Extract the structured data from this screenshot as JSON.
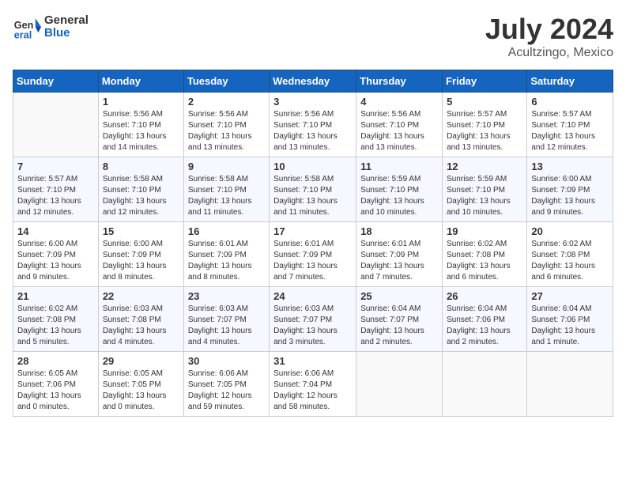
{
  "logo": {
    "line1": "General",
    "line2": "Blue"
  },
  "title": {
    "month_year": "July 2024",
    "location": "Acultzingo, Mexico"
  },
  "days_of_week": [
    "Sunday",
    "Monday",
    "Tuesday",
    "Wednesday",
    "Thursday",
    "Friday",
    "Saturday"
  ],
  "weeks": [
    [
      {
        "day": "",
        "info": ""
      },
      {
        "day": "1",
        "info": "Sunrise: 5:56 AM\nSunset: 7:10 PM\nDaylight: 13 hours\nand 14 minutes."
      },
      {
        "day": "2",
        "info": "Sunrise: 5:56 AM\nSunset: 7:10 PM\nDaylight: 13 hours\nand 13 minutes."
      },
      {
        "day": "3",
        "info": "Sunrise: 5:56 AM\nSunset: 7:10 PM\nDaylight: 13 hours\nand 13 minutes."
      },
      {
        "day": "4",
        "info": "Sunrise: 5:56 AM\nSunset: 7:10 PM\nDaylight: 13 hours\nand 13 minutes."
      },
      {
        "day": "5",
        "info": "Sunrise: 5:57 AM\nSunset: 7:10 PM\nDaylight: 13 hours\nand 13 minutes."
      },
      {
        "day": "6",
        "info": "Sunrise: 5:57 AM\nSunset: 7:10 PM\nDaylight: 13 hours\nand 12 minutes."
      }
    ],
    [
      {
        "day": "7",
        "info": "Sunrise: 5:57 AM\nSunset: 7:10 PM\nDaylight: 13 hours\nand 12 minutes."
      },
      {
        "day": "8",
        "info": "Sunrise: 5:58 AM\nSunset: 7:10 PM\nDaylight: 13 hours\nand 12 minutes."
      },
      {
        "day": "9",
        "info": "Sunrise: 5:58 AM\nSunset: 7:10 PM\nDaylight: 13 hours\nand 11 minutes."
      },
      {
        "day": "10",
        "info": "Sunrise: 5:58 AM\nSunset: 7:10 PM\nDaylight: 13 hours\nand 11 minutes."
      },
      {
        "day": "11",
        "info": "Sunrise: 5:59 AM\nSunset: 7:10 PM\nDaylight: 13 hours\nand 10 minutes."
      },
      {
        "day": "12",
        "info": "Sunrise: 5:59 AM\nSunset: 7:10 PM\nDaylight: 13 hours\nand 10 minutes."
      },
      {
        "day": "13",
        "info": "Sunrise: 6:00 AM\nSunset: 7:09 PM\nDaylight: 13 hours\nand 9 minutes."
      }
    ],
    [
      {
        "day": "14",
        "info": "Sunrise: 6:00 AM\nSunset: 7:09 PM\nDaylight: 13 hours\nand 9 minutes."
      },
      {
        "day": "15",
        "info": "Sunrise: 6:00 AM\nSunset: 7:09 PM\nDaylight: 13 hours\nand 8 minutes."
      },
      {
        "day": "16",
        "info": "Sunrise: 6:01 AM\nSunset: 7:09 PM\nDaylight: 13 hours\nand 8 minutes."
      },
      {
        "day": "17",
        "info": "Sunrise: 6:01 AM\nSunset: 7:09 PM\nDaylight: 13 hours\nand 7 minutes."
      },
      {
        "day": "18",
        "info": "Sunrise: 6:01 AM\nSunset: 7:09 PM\nDaylight: 13 hours\nand 7 minutes."
      },
      {
        "day": "19",
        "info": "Sunrise: 6:02 AM\nSunset: 7:08 PM\nDaylight: 13 hours\nand 6 minutes."
      },
      {
        "day": "20",
        "info": "Sunrise: 6:02 AM\nSunset: 7:08 PM\nDaylight: 13 hours\nand 6 minutes."
      }
    ],
    [
      {
        "day": "21",
        "info": "Sunrise: 6:02 AM\nSunset: 7:08 PM\nDaylight: 13 hours\nand 5 minutes."
      },
      {
        "day": "22",
        "info": "Sunrise: 6:03 AM\nSunset: 7:08 PM\nDaylight: 13 hours\nand 4 minutes."
      },
      {
        "day": "23",
        "info": "Sunrise: 6:03 AM\nSunset: 7:07 PM\nDaylight: 13 hours\nand 4 minutes."
      },
      {
        "day": "24",
        "info": "Sunrise: 6:03 AM\nSunset: 7:07 PM\nDaylight: 13 hours\nand 3 minutes."
      },
      {
        "day": "25",
        "info": "Sunrise: 6:04 AM\nSunset: 7:07 PM\nDaylight: 13 hours\nand 2 minutes."
      },
      {
        "day": "26",
        "info": "Sunrise: 6:04 AM\nSunset: 7:06 PM\nDaylight: 13 hours\nand 2 minutes."
      },
      {
        "day": "27",
        "info": "Sunrise: 6:04 AM\nSunset: 7:06 PM\nDaylight: 13 hours\nand 1 minute."
      }
    ],
    [
      {
        "day": "28",
        "info": "Sunrise: 6:05 AM\nSunset: 7:06 PM\nDaylight: 13 hours\nand 0 minutes."
      },
      {
        "day": "29",
        "info": "Sunrise: 6:05 AM\nSunset: 7:05 PM\nDaylight: 13 hours\nand 0 minutes."
      },
      {
        "day": "30",
        "info": "Sunrise: 6:06 AM\nSunset: 7:05 PM\nDaylight: 12 hours\nand 59 minutes."
      },
      {
        "day": "31",
        "info": "Sunrise: 6:06 AM\nSunset: 7:04 PM\nDaylight: 12 hours\nand 58 minutes."
      },
      {
        "day": "",
        "info": ""
      },
      {
        "day": "",
        "info": ""
      },
      {
        "day": "",
        "info": ""
      }
    ]
  ]
}
